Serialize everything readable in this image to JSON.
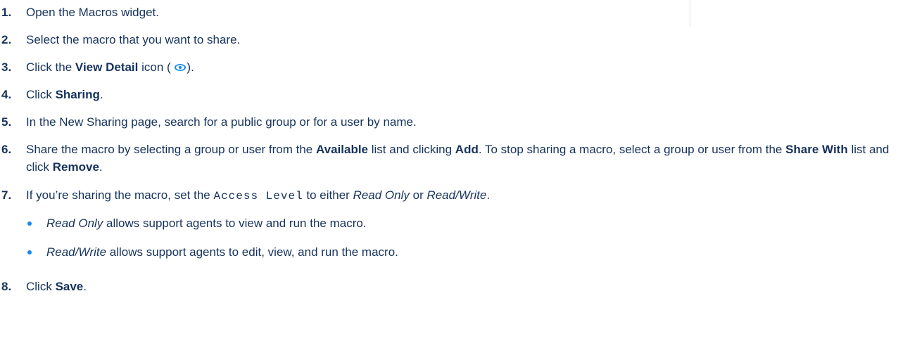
{
  "steps": [
    {
      "number": "1.",
      "text": "Open the Macros widget."
    },
    {
      "number": "2.",
      "text": "Select the macro that you want to share."
    },
    {
      "number": "3.",
      "pre": "Click the ",
      "bold": "View Detail",
      "mid": " icon ( ",
      "icon": "eye-icon",
      "post": ")."
    },
    {
      "number": "4.",
      "pre": "Click ",
      "bold": "Sharing",
      "post": "."
    },
    {
      "number": "5.",
      "text": "In the New Sharing page, search for a public group or for a user by name."
    },
    {
      "number": "6.",
      "t1": "Share the macro by selecting a group or user from the ",
      "b1": "Available",
      "t2": " list and clicking ",
      "b2": "Add",
      "t3": ". To stop sharing a macro, select a group or user from the ",
      "b3": "Share With",
      "t4": " list and click ",
      "b4": "Remove",
      "t5": "."
    },
    {
      "number": "7.",
      "pre": "If you’re sharing the macro, set the ",
      "code": "Access Level",
      "mid": " to either ",
      "i1": "Read Only",
      "mid2": " or ",
      "i2": "Read/Write",
      "post": "."
    },
    {
      "number": "8.",
      "pre": "Click ",
      "bold": "Save",
      "post": "."
    }
  ],
  "sub_items": [
    {
      "italic": "Read Only",
      "text": " allows support agents to view and run the macro."
    },
    {
      "italic": "Read/Write",
      "text": " allows support agents to edit, view, and run the macro."
    }
  ],
  "colors": {
    "text": "#16325c",
    "accent": "#1589ee"
  }
}
